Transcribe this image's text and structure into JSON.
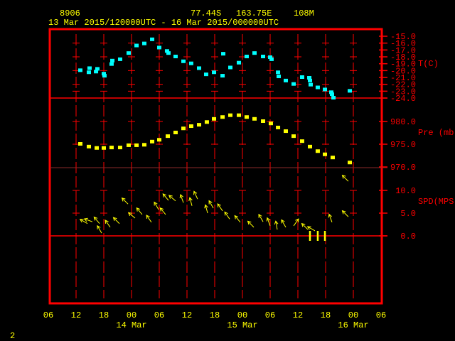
{
  "header": {
    "station": "8906",
    "lat": "77.44S",
    "lon": "163.75E",
    "elev": "108M",
    "period": "13 Mar 2015/120000UTC - 16 Mar 2015/000000UTC"
  },
  "page_number": "2",
  "colors": {
    "frame": "#ff0000",
    "text": "#ffff00",
    "temperature": "#00ffff",
    "pressure": "#ffff00",
    "wind": "#ffff00"
  },
  "chart_data": {
    "type": "scatter",
    "x_axis": {
      "range": [
        "2015-03-13T06:00",
        "2015-03-16T06:00"
      ],
      "tick_labels": [
        "06",
        "12",
        "18",
        "00",
        "06",
        "12",
        "18",
        "00",
        "06",
        "12",
        "18",
        "00",
        "06"
      ],
      "date_labels": [
        {
          "label": "14 Mar",
          "at": "2015-03-14T00:00"
        },
        {
          "label": "15 Mar",
          "at": "2015-03-15T00:00"
        },
        {
          "label": "16 Mar",
          "at": "2015-03-16T00:00"
        }
      ],
      "grid": true
    },
    "panels": [
      {
        "name": "T(C)",
        "ylim": [
          -24,
          -15
        ],
        "tick_labels": [
          "-15.0",
          "-16.0",
          "-17.0",
          "-18.0",
          "-19.0",
          "-20.0",
          "-21.0",
          "-22.0",
          "-23.0",
          "-24.0"
        ],
        "marker": "square",
        "points": [
          [
            "2015-03-13T12:55",
            -20.0
          ],
          [
            "2015-03-13T14:55",
            -19.7
          ],
          [
            "2015-03-13T14:46",
            -20.3
          ],
          [
            "2015-03-13T16:19",
            -20.2
          ],
          [
            "2015-03-13T16:37",
            -19.8
          ],
          [
            "2015-03-13T18:00",
            -20.5
          ],
          [
            "2015-03-13T18:09",
            -20.8
          ],
          [
            "2015-03-13T19:41",
            -19.1
          ],
          [
            "2015-03-13T19:51",
            -18.6
          ],
          [
            "2015-03-13T21:32",
            -18.4
          ],
          [
            "2015-03-13T23:23",
            -17.5
          ],
          [
            "2015-03-14T01:05",
            -16.4
          ],
          [
            "2015-03-14T02:46",
            -16.1
          ],
          [
            "2015-03-14T04:28",
            -15.5
          ],
          [
            "2015-03-14T06:00",
            -16.7
          ],
          [
            "2015-03-14T07:41",
            -17.2
          ],
          [
            "2015-03-14T08:00",
            -17.5
          ],
          [
            "2015-03-14T09:32",
            -18.0
          ],
          [
            "2015-03-14T11:14",
            -18.7
          ],
          [
            "2015-03-14T12:55",
            -19.0
          ],
          [
            "2015-03-14T14:37",
            -19.7
          ],
          [
            "2015-03-14T16:09",
            -20.6
          ],
          [
            "2015-03-14T17:51",
            -20.3
          ],
          [
            "2015-03-14T19:42",
            -20.8
          ],
          [
            "2015-03-14T19:51",
            -17.6
          ],
          [
            "2015-03-14T21:23",
            -19.6
          ],
          [
            "2015-03-14T23:14",
            -18.9
          ],
          [
            "2015-03-15T00:55",
            -18.0
          ],
          [
            "2015-03-15T02:37",
            -17.5
          ],
          [
            "2015-03-15T04:28",
            -18.0
          ],
          [
            "2015-03-15T06:00",
            -18.1
          ],
          [
            "2015-03-15T06:18",
            -18.4
          ],
          [
            "2015-03-15T07:42",
            -20.3
          ],
          [
            "2015-03-15T07:51",
            -20.9
          ],
          [
            "2015-03-15T09:23",
            -21.5
          ],
          [
            "2015-03-15T11:05",
            -22.0
          ],
          [
            "2015-03-15T12:55",
            -21.0
          ],
          [
            "2015-03-15T14:28",
            -21.1
          ],
          [
            "2015-03-15T14:37",
            -21.5
          ],
          [
            "2015-03-15T14:46",
            -22.1
          ],
          [
            "2015-03-15T16:18",
            -22.5
          ],
          [
            "2015-03-15T17:51",
            -22.8
          ],
          [
            "2015-03-15T19:14",
            -23.2
          ],
          [
            "2015-03-15T19:23",
            -23.5
          ],
          [
            "2015-03-15T19:42",
            -24.0
          ],
          [
            "2015-03-15T23:14",
            -23.0
          ]
        ]
      },
      {
        "name": "Pre (mb)",
        "ylim": [
          970,
          981.5
        ],
        "tick_labels": [
          "980.0",
          "975.0",
          "970.0"
        ],
        "ticks": [
          980,
          975,
          970
        ],
        "marker": "square",
        "points": [
          [
            "2015-03-13T12:55",
            975.0
          ],
          [
            "2015-03-13T14:46",
            974.4
          ],
          [
            "2015-03-13T16:28",
            974.1
          ],
          [
            "2015-03-13T18:00",
            974.1
          ],
          [
            "2015-03-13T19:41",
            974.2
          ],
          [
            "2015-03-13T21:32",
            974.2
          ],
          [
            "2015-03-13T23:23",
            974.7
          ],
          [
            "2015-03-14T01:05",
            974.7
          ],
          [
            "2015-03-14T02:46",
            974.8
          ],
          [
            "2015-03-14T04:28",
            975.5
          ],
          [
            "2015-03-14T06:00",
            975.9
          ],
          [
            "2015-03-14T07:51",
            976.7
          ],
          [
            "2015-03-14T09:32",
            977.5
          ],
          [
            "2015-03-14T11:14",
            978.4
          ],
          [
            "2015-03-14T12:55",
            978.9
          ],
          [
            "2015-03-14T14:37",
            979.2
          ],
          [
            "2015-03-14T16:18",
            979.8
          ],
          [
            "2015-03-14T17:51",
            980.5
          ],
          [
            "2015-03-14T19:42",
            980.9
          ],
          [
            "2015-03-14T21:23",
            981.3
          ],
          [
            "2015-03-14T23:14",
            981.3
          ],
          [
            "2015-03-15T00:55",
            980.9
          ],
          [
            "2015-03-15T02:37",
            980.5
          ],
          [
            "2015-03-15T04:28",
            980.0
          ],
          [
            "2015-03-15T06:09",
            979.5
          ],
          [
            "2015-03-15T07:42",
            978.6
          ],
          [
            "2015-03-15T09:23",
            977.8
          ],
          [
            "2015-03-15T11:05",
            976.7
          ],
          [
            "2015-03-15T12:55",
            975.6
          ],
          [
            "2015-03-15T14:37",
            974.4
          ],
          [
            "2015-03-15T16:18",
            973.4
          ],
          [
            "2015-03-15T17:51",
            972.7
          ],
          [
            "2015-03-15T19:32",
            972.0
          ],
          [
            "2015-03-15T23:14",
            970.9
          ]
        ]
      },
      {
        "name": "SPD(MPS)",
        "ylim": [
          0,
          10
        ],
        "tick_labels": [
          "10.0",
          "5.0",
          "0.0"
        ],
        "ticks": [
          10,
          5,
          0
        ],
        "marker": "wind-arrow",
        "points_time_speed_dirto": [
          [
            "2015-03-13T14:28",
            2.7,
            300
          ],
          [
            "2015-03-13T15:32",
            3.1,
            290
          ],
          [
            "2015-03-13T17:05",
            2.7,
            320
          ],
          [
            "2015-03-13T17:32",
            0.6,
            330
          ],
          [
            "2015-03-13T19:23",
            1.9,
            325
          ],
          [
            "2015-03-13T21:23",
            2.7,
            315
          ],
          [
            "2015-03-13T23:14",
            7.0,
            315
          ],
          [
            "2015-03-14T00:46",
            3.9,
            310
          ],
          [
            "2015-03-14T02:18",
            4.7,
            320
          ],
          [
            "2015-03-14T04:18",
            3.0,
            325
          ],
          [
            "2015-03-14T05:51",
            5.8,
            330
          ],
          [
            "2015-03-14T07:23",
            4.7,
            320
          ],
          [
            "2015-03-14T08:00",
            7.8,
            320
          ],
          [
            "2015-03-14T09:32",
            7.7,
            310
          ],
          [
            "2015-03-14T11:14",
            7.3,
            340
          ],
          [
            "2015-03-14T13:05",
            6.6,
            345
          ],
          [
            "2015-03-14T14:18",
            8.1,
            335
          ],
          [
            "2015-03-14T16:28",
            5.0,
            345
          ],
          [
            "2015-03-14T17:42",
            6.1,
            330
          ],
          [
            "2015-03-14T19:42",
            5.5,
            325
          ],
          [
            "2015-03-14T21:14",
            3.7,
            325
          ],
          [
            "2015-03-14T23:32",
            3.0,
            320
          ],
          [
            "2015-03-15T02:28",
            1.9,
            315
          ],
          [
            "2015-03-15T04:28",
            3.1,
            330
          ],
          [
            "2015-03-15T06:00",
            2.2,
            340
          ],
          [
            "2015-03-15T07:32",
            1.4,
            350
          ],
          [
            "2015-03-15T09:23",
            1.9,
            330
          ],
          [
            "2015-03-15T11:05",
            2.2,
            35
          ],
          [
            "2015-03-15T14:09",
            1.4,
            315
          ],
          [
            "2015-03-15T15:42",
            1.1,
            300
          ],
          [
            "2015-03-15T19:23",
            3.0,
            340
          ],
          [
            "2015-03-15T22:55",
            4.2,
            315
          ],
          [
            "2015-03-15T22:55",
            12.0,
            315
          ]
        ],
        "calm_markers": [
          "2015-03-15T14:37",
          "2015-03-15T16:18",
          "2015-03-15T17:51"
        ]
      }
    ]
  }
}
